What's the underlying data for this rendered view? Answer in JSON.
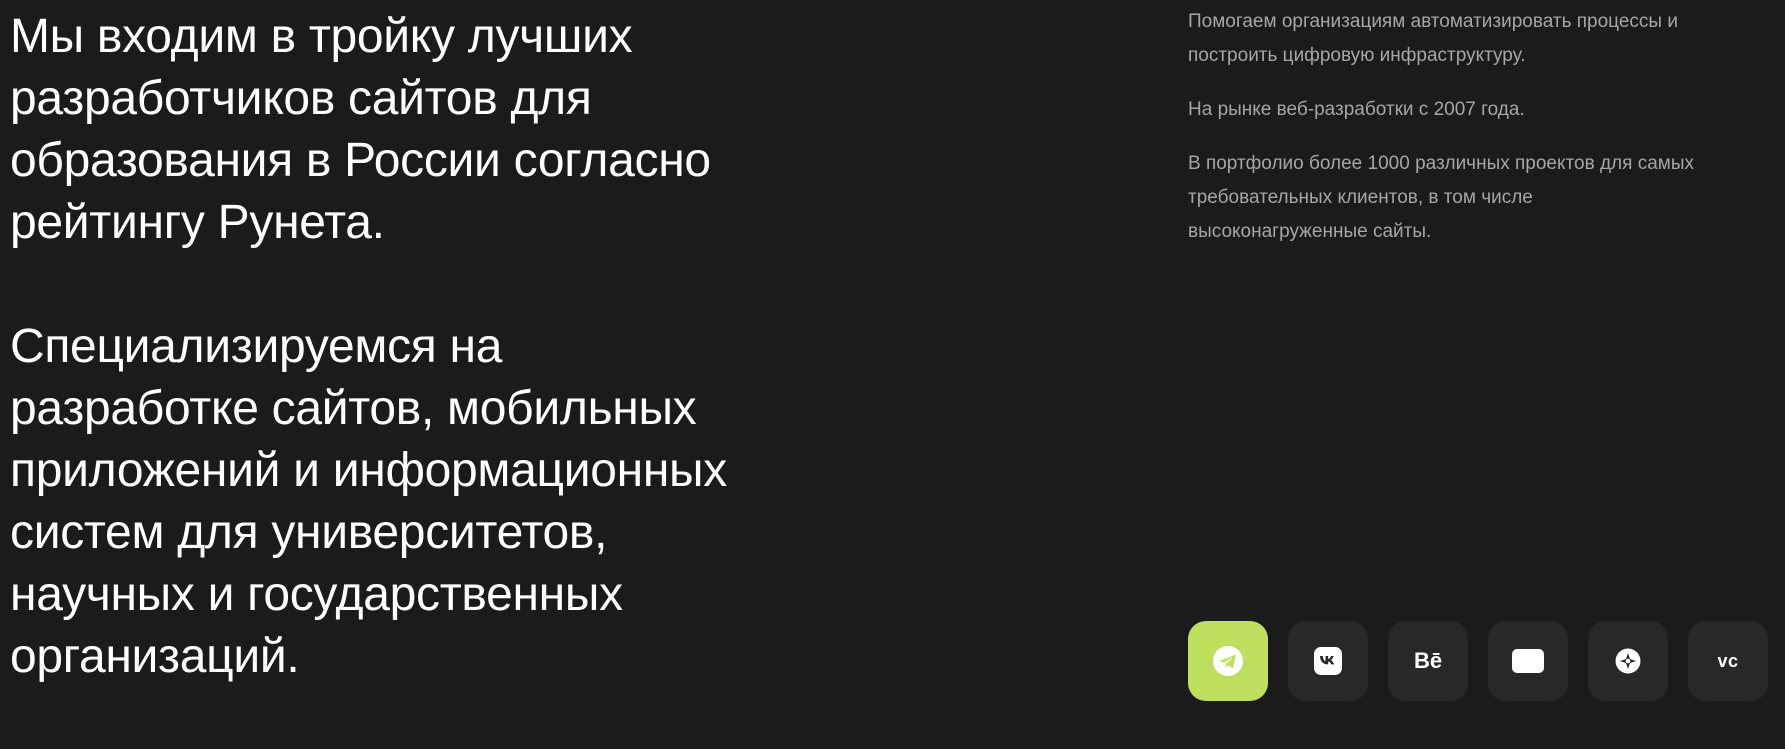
{
  "headline_1": {
    "lines": [
      "Мы входим в тройку лучших",
      "разработчиков сайтов для",
      "образования в России согласно",
      "рейтингу Рунета."
    ]
  },
  "headline_2": {
    "lines": [
      "Специализируемся на",
      "разработке сайтов, мобильных",
      "приложений и информационных",
      "систем для университетов,",
      "научных и государственных",
      "организаций."
    ]
  },
  "info": {
    "paragraph_1": [
      "Помогаем организациям автоматизировать процессы и",
      "построить цифровую инфраструктуру."
    ],
    "paragraph_2": [
      "На рынке веб-разработки с 2007 года."
    ],
    "paragraph_3": [
      "В портфолио более 1000 различных проектов для самых",
      "требовательных клиентов, в том числе",
      "высоконагруженные сайты."
    ]
  },
  "socials": [
    {
      "icon": "telegram-icon",
      "active": true
    },
    {
      "icon": "vk-icon",
      "active": false
    },
    {
      "icon": "behance-icon",
      "label": "Bē",
      "active": false
    },
    {
      "icon": "youtube-icon",
      "active": false
    },
    {
      "icon": "dribbble-icon",
      "active": false
    },
    {
      "icon": "vc-icon",
      "label": "vc",
      "active": false
    }
  ],
  "colors": {
    "background": "#1b1b1b",
    "headline": "#ffffff",
    "body_text": "#a6a6a6",
    "social_bg": "#282828",
    "accent": "#bfe05f"
  }
}
